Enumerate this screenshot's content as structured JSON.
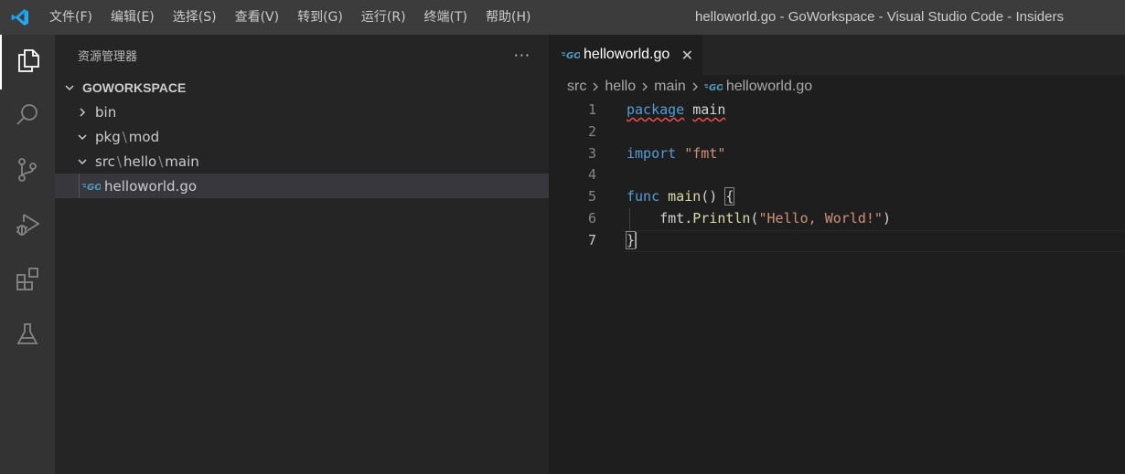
{
  "window": {
    "title": "helloworld.go - GoWorkspace - Visual Studio Code - Insiders",
    "accent_color": "#23a9f2"
  },
  "menubar": {
    "items": [
      "文件(F)",
      "编辑(E)",
      "选择(S)",
      "查看(V)",
      "转到(G)",
      "运行(R)",
      "终端(T)",
      "帮助(H)"
    ]
  },
  "activitybar": {
    "items": [
      {
        "name": "explorer",
        "icon": "files-icon",
        "active": true
      },
      {
        "name": "search",
        "icon": "search-icon",
        "active": false
      },
      {
        "name": "source-control",
        "icon": "source-control-icon",
        "active": false
      },
      {
        "name": "run-and-debug",
        "icon": "run-debug-icon",
        "active": false
      },
      {
        "name": "extensions",
        "icon": "extensions-icon",
        "active": false
      },
      {
        "name": "testing",
        "icon": "flask-icon",
        "active": false
      }
    ]
  },
  "sidebar": {
    "title": "资源管理器",
    "more_actions": "···",
    "workspace": "GOWORKSPACE",
    "tree": [
      {
        "parts": [
          "bin"
        ],
        "expanded": false
      },
      {
        "parts": [
          "pkg",
          "mod"
        ],
        "expanded": true
      },
      {
        "parts": [
          "src",
          "hello",
          "main"
        ],
        "expanded": true
      },
      {
        "file": "helloworld.go",
        "selected": true,
        "icon": "go-file-icon"
      }
    ],
    "path_separator": "\\"
  },
  "editor": {
    "tab": {
      "label": "helloworld.go",
      "close": "✕",
      "icon": "go-file-icon"
    },
    "breadcrumbs": [
      "src",
      "hello",
      "main",
      "helloworld.go"
    ],
    "current_line": 7,
    "lines": [
      {
        "n": "1",
        "tokens": [
          [
            "kw sq",
            "package"
          ],
          [
            "id",
            " "
          ],
          [
            "id sq",
            "main"
          ]
        ]
      },
      {
        "n": "2",
        "tokens": []
      },
      {
        "n": "3",
        "tokens": [
          [
            "kw",
            "import"
          ],
          [
            "id",
            " "
          ],
          [
            "str",
            "\"fmt\""
          ]
        ]
      },
      {
        "n": "4",
        "tokens": []
      },
      {
        "n": "5",
        "tokens": [
          [
            "kw",
            "func"
          ],
          [
            "id",
            " "
          ],
          [
            "fn",
            "main"
          ],
          [
            "id",
            "() "
          ],
          [
            "id br",
            "{"
          ]
        ]
      },
      {
        "n": "6",
        "tokens": [
          [
            "id",
            "    fmt."
          ],
          [
            "fn",
            "Println"
          ],
          [
            "id",
            "("
          ],
          [
            "str",
            "\"Hello, World!\""
          ],
          [
            "id",
            ")"
          ]
        ]
      },
      {
        "n": "7",
        "tokens": [
          [
            "id br",
            "}"
          ]
        ]
      }
    ]
  }
}
